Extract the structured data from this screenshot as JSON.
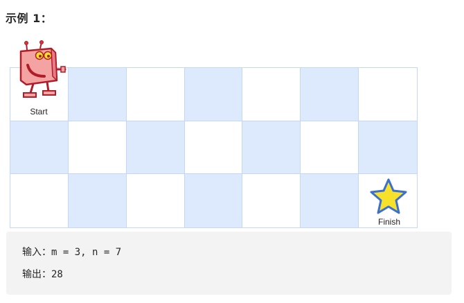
{
  "example": {
    "heading": "示例 1："
  },
  "grid": {
    "rows": 3,
    "cols": 7,
    "start_label": "Start",
    "finish_label": "Finish"
  },
  "code": {
    "input_line": "输入：m = 3, n = 7",
    "output_line": "输出：28"
  },
  "colors": {
    "shaded_cell": "#dde9fc",
    "grid_line": "#c4d8f5",
    "robot_body": "#f4a3a3",
    "robot_outline": "#b01c28",
    "star_fill": "#f7e12a",
    "star_outline": "#3b6fd1"
  },
  "icons": {
    "start": "robot-icon",
    "finish": "star-icon"
  }
}
